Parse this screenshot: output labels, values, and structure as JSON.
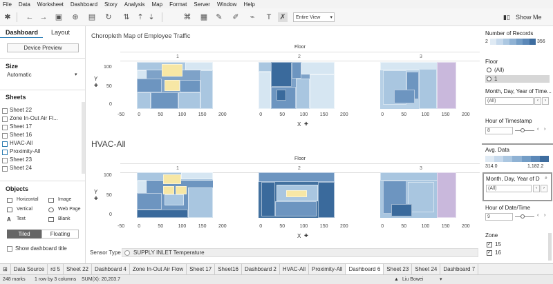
{
  "menu": [
    "File",
    "Data",
    "Worksheet",
    "Dashboard",
    "Story",
    "Analysis",
    "Map",
    "Format",
    "Server",
    "Window",
    "Help"
  ],
  "toolbar": {
    "view_select": "Entire View",
    "show_me": "Show Me"
  },
  "left_panel": {
    "tabs": [
      "Dashboard",
      "Layout"
    ],
    "device_preview": "Device Preview",
    "size_title": "Size",
    "size_value": "Automatic",
    "sheets_title": "Sheets",
    "sheets": [
      "Sheet 22",
      "Zone In-Out Air Fl...",
      "Sheet 17",
      "Sheet 16",
      "HVAC-All",
      "Proximity-All",
      "Sheet 23",
      "Sheet 24"
    ],
    "objects_title": "Objects",
    "objects": [
      "Horizontal",
      "Image",
      "Vertical",
      "Web Page",
      "Text",
      "Blank"
    ],
    "tiled": "Tiled",
    "floating": "Floating",
    "show_title": "Show dashboard title"
  },
  "viz1": {
    "title": "Choropleth Map of Employee Traffic",
    "floor_header": "Floor",
    "columns": [
      "1",
      "2",
      "3"
    ],
    "y_label": "Y",
    "x_label": "X",
    "y_ticks": [
      "100",
      "50",
      "0"
    ],
    "x_ticks": [
      "-50",
      "0",
      "50",
      "100",
      "150",
      "200"
    ]
  },
  "viz2": {
    "title": "HVAC-All",
    "floor_header": "Floor",
    "columns": [
      "1",
      "2",
      "3"
    ],
    "y_label": "Y",
    "x_label": "X",
    "y_ticks": [
      "100",
      "50",
      "0"
    ],
    "x_ticks": [
      "-50",
      "0",
      "50",
      "100",
      "150",
      "200"
    ]
  },
  "sensor_filter": {
    "label": "Sensor Type",
    "value": "SUPPLY INLET Temperature"
  },
  "right_panel": {
    "records_title": "Number of Records",
    "records_min": "2",
    "records_max": "356",
    "floor_title": "Floor",
    "floor_options": [
      "(All)",
      "1"
    ],
    "mdy_title": "Month, Day, Year of Time...",
    "mdy_value": "(All)",
    "hour_title": "Hour of Timestamp",
    "hour_value": "8",
    "avg_title": "Avg. Data",
    "avg_min": "314.0",
    "avg_max": "1,182.2",
    "mdy2_title": "Month, Day, Year of D",
    "mdy2_value": "(All)",
    "hour2_title": "Hour of Date/Time",
    "hour2_value": "9",
    "zone_title": "Zone",
    "zone_options": [
      "15",
      "16"
    ]
  },
  "tabs": [
    "Data Source",
    "rd 5",
    "Sheet 22",
    "Dashboard 4",
    "Zone In-Out Air Flow",
    "Sheet 17",
    "Sheet16",
    "Dashboard 2",
    "HVAC-All",
    "Proximity-All",
    "Dashboard 6",
    "Sheet 23",
    "Sheet 24",
    "Dashboard 7"
  ],
  "active_tab": "Dashboard 6",
  "status": {
    "marks": "248 marks",
    "layout": "1 row by 3 columns",
    "sum": "SUM(X): 20,203.7",
    "user": "Liu Bowei"
  },
  "colors": {
    "dark": "#3a6a9c",
    "mid": "#6d95c0",
    "light": "#a9c6e0",
    "pale": "#d6e6f2",
    "lilac": "#c9b8dc",
    "note": "#f7e7a5"
  }
}
